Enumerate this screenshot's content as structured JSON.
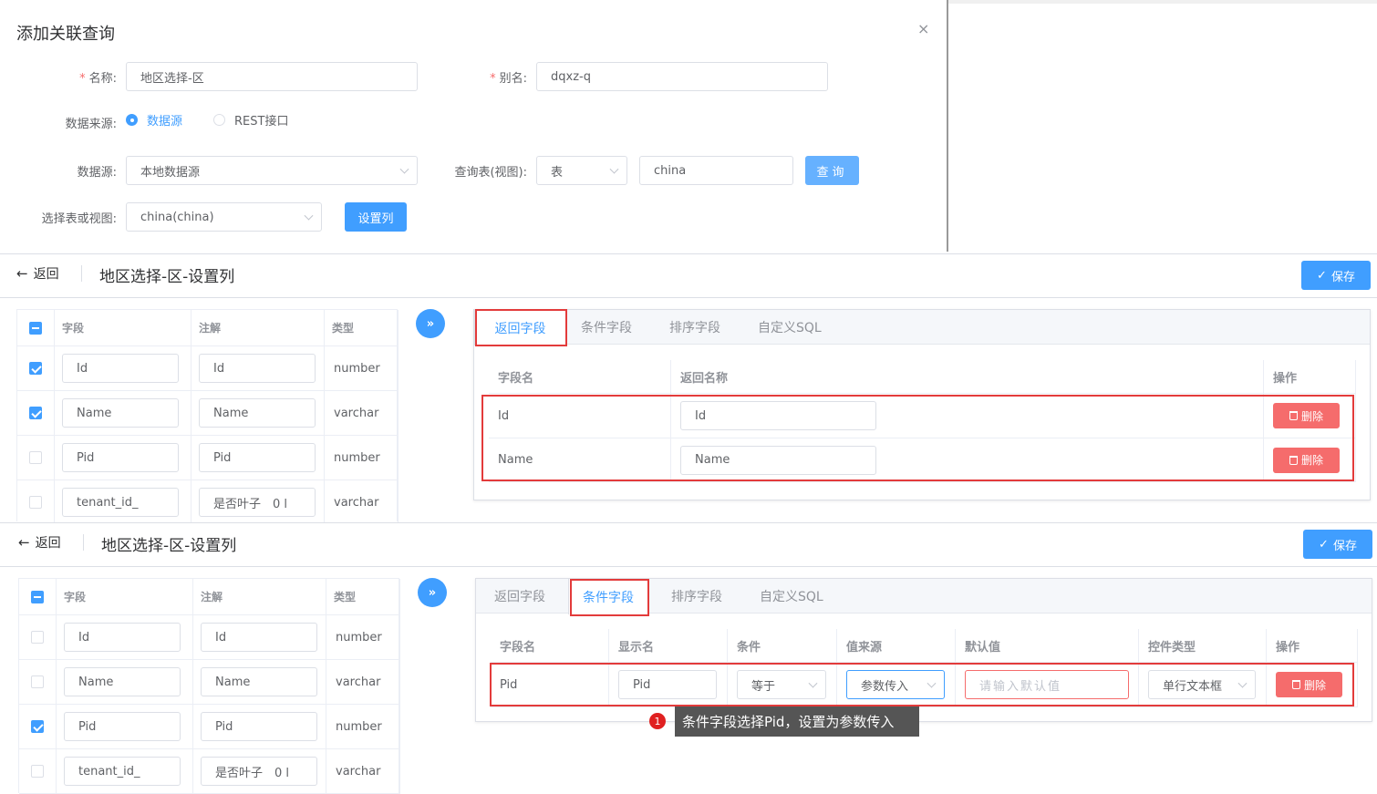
{
  "dialog": {
    "title": "添加关联查询",
    "close": "×",
    "name_label": "名称:",
    "name_value": "地区选择-区",
    "alias_label": "别名:",
    "alias_value": "dqxz-q",
    "source_label": "数据来源:",
    "source_options": [
      "数据源",
      "REST接口"
    ],
    "datasource_label": "数据源:",
    "datasource_value": "本地数据源",
    "query_table_label": "查询表(视图):",
    "query_table_type": "表",
    "query_table_value": "china",
    "query_button": "查询",
    "select_table_label": "选择表或视图:",
    "select_table_value": "china(china)",
    "set_columns_button": "设置列"
  },
  "panel1": {
    "back": "返回",
    "title": "地区选择-区-设置列",
    "save": "保存",
    "left_headers": [
      "字段",
      "注解",
      "类型"
    ],
    "left_rows": [
      {
        "field": "Id",
        "comment": "Id",
        "type": "number",
        "checked": true
      },
      {
        "field": "Name",
        "comment": "Name",
        "type": "varchar",
        "checked": true
      },
      {
        "field": "Pid",
        "comment": "Pid",
        "type": "number",
        "checked": false
      },
      {
        "field": "tenant_id_",
        "comment": "是否叶子　0 l",
        "type": "varchar",
        "checked": false
      }
    ],
    "tabs": [
      "返回字段",
      "条件字段",
      "排序字段",
      "自定义SQL"
    ],
    "headers": [
      "字段名",
      "返回名称",
      "操作"
    ],
    "rows": [
      {
        "field": "Id",
        "return_name": "Id",
        "action": "删除"
      },
      {
        "field": "Name",
        "return_name": "Name",
        "action": "删除"
      }
    ]
  },
  "panel2": {
    "back": "返回",
    "title": "地区选择-区-设置列",
    "save": "保存",
    "left_headers": [
      "字段",
      "注解",
      "类型"
    ],
    "left_rows": [
      {
        "field": "Id",
        "comment": "Id",
        "type": "number",
        "checked": false
      },
      {
        "field": "Name",
        "comment": "Name",
        "type": "varchar",
        "checked": false
      },
      {
        "field": "Pid",
        "comment": "Pid",
        "type": "number",
        "checked": true
      },
      {
        "field": "tenant_id_",
        "comment": "是否叶子　0 l",
        "type": "varchar",
        "checked": false
      }
    ],
    "tabs": [
      "返回字段",
      "条件字段",
      "排序字段",
      "自定义SQL"
    ],
    "headers": [
      "字段名",
      "显示名",
      "条件",
      "值来源",
      "默认值",
      "控件类型",
      "操作"
    ],
    "row": {
      "field": "Pid",
      "display": "Pid",
      "condition": "等于",
      "value_source": "参数传入",
      "default_placeholder": "请输入默认值",
      "control_type": "单行文本框",
      "action": "删除"
    },
    "tooltip_num": "1",
    "tooltip": "条件字段选择Pid，设置为参数传入"
  }
}
